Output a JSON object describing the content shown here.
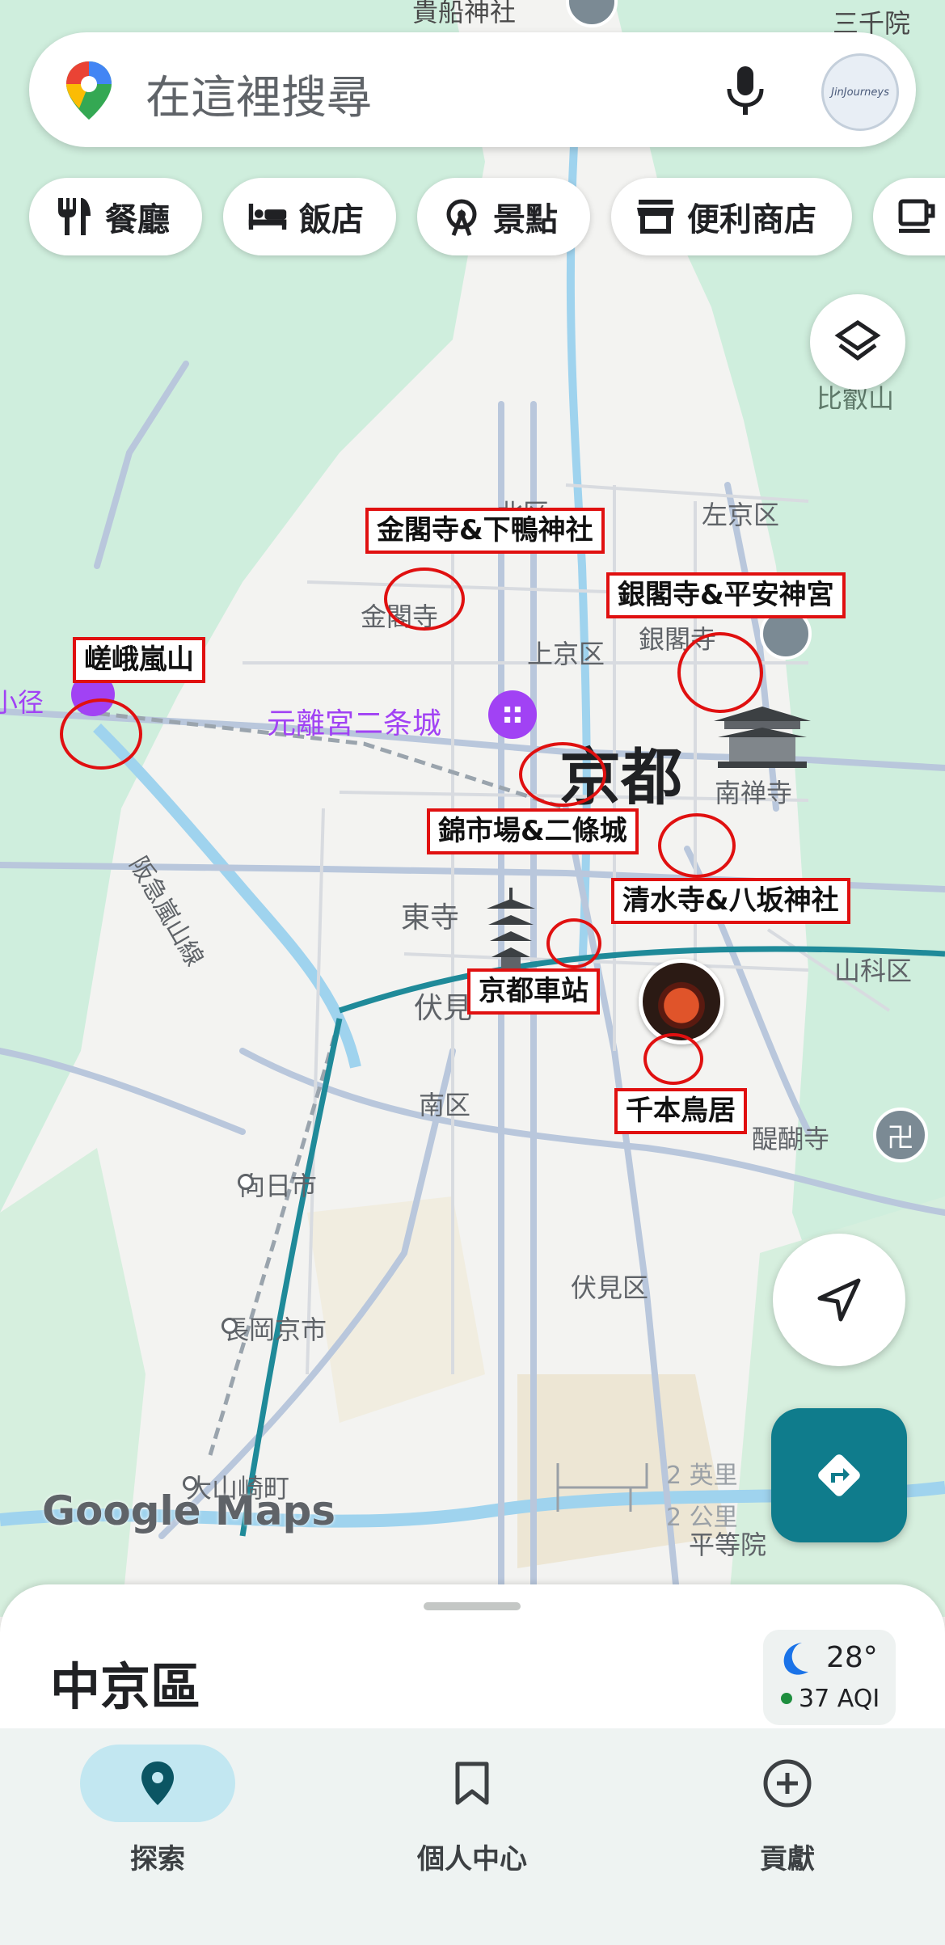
{
  "search": {
    "placeholder": "在這裡搜尋",
    "avatar_text": "JinJourneys"
  },
  "chips": [
    {
      "icon": "utensils-icon",
      "label": "餐廳"
    },
    {
      "icon": "bed-icon",
      "label": "飯店"
    },
    {
      "icon": "ferris-wheel-icon",
      "label": "景點"
    },
    {
      "icon": "store-icon",
      "label": "便利商店"
    },
    {
      "icon": "cup-icon",
      "label": ""
    }
  ],
  "map": {
    "place_labels": {
      "kibune": "貴船神社",
      "sanzenin": "三千院",
      "hieizan": "比叡山",
      "kita_ku": "北区",
      "sakyo_ku": "左京区",
      "kinkakuji": "金閣寺",
      "kamigyo_ku": "上京区",
      "ginkakuji": "銀閣寺",
      "komichi": "小径",
      "nijo_castle": "元離宮二条城",
      "kyoto": "京都",
      "nanzenji": "南禅寺",
      "hankyu_line": "阪急嵐山線",
      "toji": "東寺",
      "yamashina_ku": "山科区",
      "fushimi": "伏見",
      "minami_ku": "南区",
      "daigoji": "醍醐寺",
      "muko": "向日市",
      "fushimi_ku": "伏見区",
      "nagaokakyo": "長岡京市",
      "oyamazaki": "大山崎町",
      "byodoin": "平等院",
      "scale_miles": "2 英里",
      "scale_km": "2 公里",
      "google_maps": "Google Maps"
    },
    "annotations": [
      "金閣寺&下鴨神社",
      "銀閣寺&平安神宮",
      "嵯峨嵐山",
      "錦市場&二條城",
      "清水寺&八坂神社",
      "京都車站",
      "千本鳥居"
    ]
  },
  "sheet": {
    "title": "中京區",
    "weather": {
      "icon": "moon-icon",
      "temp": "28°",
      "aqi": "37 AQI"
    }
  },
  "nav": [
    {
      "icon": "pin-icon",
      "label": "探索",
      "active": true
    },
    {
      "icon": "bookmark-icon",
      "label": "個人中心",
      "active": false
    },
    {
      "icon": "plus-circle-icon",
      "label": "貢獻",
      "active": false
    }
  ],
  "colors": {
    "accent": "#0f7c8c",
    "annotation_red": "#e01010",
    "nav_pill": "#c2e7f1",
    "poi_purple": "#a142f4"
  }
}
